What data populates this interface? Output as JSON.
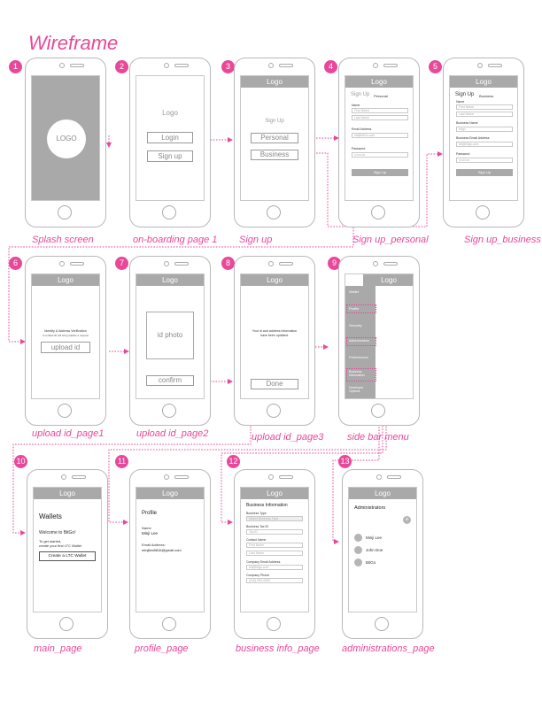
{
  "title": "Wireframe",
  "colors": {
    "accent": "#e9479a",
    "placeholder": "#a9a9a9"
  },
  "screens": {
    "s1": {
      "badge": "1",
      "caption": "Splash screen",
      "logo": "LOGO"
    },
    "s2": {
      "badge": "2",
      "caption": "on-boarding page 1",
      "logo": "Logo",
      "login": "Login",
      "signup": "Sign up"
    },
    "s3": {
      "badge": "3",
      "caption": "Sign up",
      "logo": "Logo",
      "heading": "Sign Up",
      "personal": "Personal",
      "business": "Business"
    },
    "s4": {
      "badge": "4",
      "caption": "Sign up_personal",
      "logo": "Logo",
      "heading": "Sign Up",
      "sub": "Personal",
      "name_label": "Name",
      "first": "First Name",
      "last": "Last Name",
      "email_label": "Email Address",
      "email": "bit@bitGo.com",
      "password_label": "Password",
      "password": "••••••••••",
      "button": "Sign Up"
    },
    "s5": {
      "badge": "5",
      "caption": "Sign up_business",
      "logo": "Logo",
      "heading": "Sign Up",
      "sub": "Business",
      "name_label": "Name",
      "first": "First Name",
      "last": "Last Name",
      "bname_label": "Business Name",
      "bname": "bitgo",
      "bemail_label": "Business Email Address",
      "bemail": "bit@bitgo.com",
      "password_label": "Password",
      "password": "••••••••••",
      "button": "Sign Up"
    },
    "s6": {
      "badge": "6",
      "caption": "upload id_page1",
      "logo": "Logo",
      "line1": "Identity & Address Verification",
      "line2": "A verified ID will bring wallets a request",
      "button": "upload id"
    },
    "s7": {
      "badge": "7",
      "caption": "upload id_page2",
      "logo": "Logo",
      "photo": "id photo",
      "button": "confirm"
    },
    "s8": {
      "badge": "8",
      "caption": "upload id_page3",
      "logo": "Logo",
      "line1": "Your id and address information",
      "line2": "have been updated.",
      "button": "Done"
    },
    "s9": {
      "badge": "9",
      "caption": "side bar menu",
      "logo": "Logo",
      "menu": [
        "Wallet",
        "Profile",
        "Security",
        "Administrators",
        "Preferences",
        "Business Information",
        "Developer Options"
      ]
    },
    "s10": {
      "badge": "10",
      "caption": "main_page",
      "logo": "Logo",
      "heading": "Wallets",
      "welcome": "Welcome to BitGo!",
      "line1": "To get started,",
      "line2": "create your first LTC Wallet",
      "button": "Create a LTC Wallet"
    },
    "s11": {
      "badge": "11",
      "caption": "profile_page",
      "logo": "Logo",
      "heading": "Profile",
      "name_label": "Name",
      "name": "Minji Lee",
      "email_label": "Email Address:",
      "email": "minjilee8816@gmail.com"
    },
    "s12": {
      "badge": "12",
      "caption": "business info_page",
      "logo": "Logo",
      "heading": "Business Information",
      "type_label": "Business Type",
      "type": "Select Business Type",
      "tax_label": "Business Tax ID",
      "tax": "Tax ID",
      "contact_label": "Contact Name",
      "first": "First Name",
      "last": "Last Name",
      "cemail_label": "Company Email Address",
      "cemail": "bit@bitgo.com",
      "phone_label": "Company Phone",
      "phone": "(415)-000-0000"
    },
    "s13": {
      "badge": "13",
      "caption": "administrations_page",
      "logo": "Logo",
      "heading": "Administrators",
      "add": "+",
      "admins": [
        "Minji Lee",
        "John Doe",
        "BitGo"
      ]
    }
  }
}
